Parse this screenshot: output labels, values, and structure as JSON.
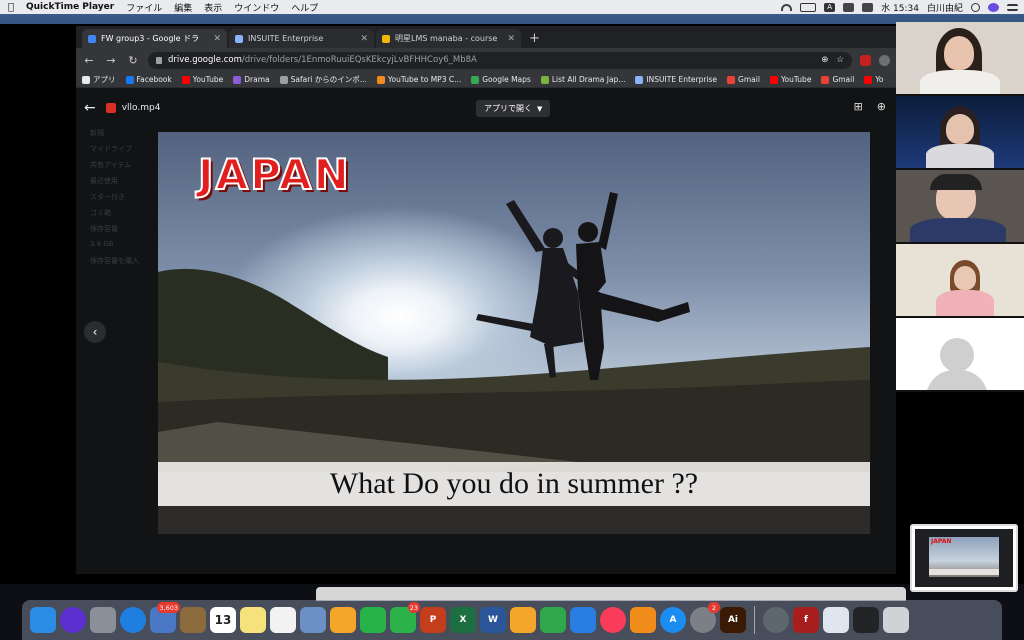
{
  "menubar": {
    "app_name": "QuickTime Player",
    "items": [
      "ファイル",
      "編集",
      "表示",
      "ウインドウ",
      "ヘルプ"
    ],
    "clock": "水 15:34",
    "user": "白川由紀",
    "input_indicator": "A"
  },
  "browser": {
    "tabs": [
      {
        "label": "FW group3 - Google ドラ",
        "color": "#4285f4"
      },
      {
        "label": "INSUITE Enterprise",
        "color": "#8ab4f8"
      },
      {
        "label": "明星LMS manaba - course",
        "color": "#f2b705"
      }
    ],
    "new_tab_symbol": "+",
    "url_host": "drive.google.com",
    "url_path": "/drive/folders/1EnmoRuuiEQsKEkcyjLvBFHHCoy6_Mb8A",
    "bookmarks": [
      {
        "label": "アプリ",
        "color": "#e8eaed"
      },
      {
        "label": "Facebook",
        "color": "#1877f2"
      },
      {
        "label": "YouTube",
        "color": "#ff0000"
      },
      {
        "label": "Drama",
        "color": "#8e5bd9"
      },
      {
        "label": "Safari からのインポ...",
        "color": "#9aa0a6"
      },
      {
        "label": "YouTube to MP3 C...",
        "color": "#f28b1e"
      },
      {
        "label": "Google Maps",
        "color": "#34a853"
      },
      {
        "label": "List All Drama Jap...",
        "color": "#7cb342"
      },
      {
        "label": "INSUITE Enterprise",
        "color": "#8ab4f8"
      },
      {
        "label": "Gmail",
        "color": "#ea4335"
      },
      {
        "label": "YouTube",
        "color": "#ff0000"
      },
      {
        "label": "Gmail",
        "color": "#ea4335"
      },
      {
        "label": "Yo",
        "color": "#ff0000"
      }
    ]
  },
  "drive_preview": {
    "file_name": "vllo.mp4",
    "open_with_label": "アプリで開く",
    "sidebar_items": [
      "新規",
      "マイドライブ",
      "共有アイテム",
      "最近使用",
      "スター付き",
      "ゴミ箱",
      "保存容量",
      "3.8 GB",
      "保存容量を購入"
    ]
  },
  "video": {
    "title_text": "JAPAN",
    "caption": "What Do you do in summer ??"
  },
  "self_view": {
    "title_text": "JAPAN",
    "caption": "What Do you do in summer ??"
  },
  "dock": {
    "apps": [
      {
        "name": "finder",
        "color": "#2b8ce6",
        "label": ""
      },
      {
        "name": "siri",
        "color": "#5b2fd0",
        "label": ""
      },
      {
        "name": "launchpad",
        "color": "#8a8f98",
        "label": ""
      },
      {
        "name": "safari",
        "color": "#1e7fe0",
        "label": ""
      },
      {
        "name": "photos-preview",
        "color": "#4a78c4",
        "label": "",
        "badge": "3,603"
      },
      {
        "name": "notebook",
        "color": "#8b6a3b",
        "label": ""
      },
      {
        "name": "calendar",
        "color": "#ffffff",
        "label": "13"
      },
      {
        "name": "notes",
        "color": "#f6e27a",
        "label": ""
      },
      {
        "name": "reminders",
        "color": "#f2f2f2",
        "label": ""
      },
      {
        "name": "preview",
        "color": "#6d8fc7",
        "label": ""
      },
      {
        "name": "photos",
        "color": "#f4a62a",
        "label": ""
      },
      {
        "name": "messages",
        "color": "#27b24a",
        "label": ""
      },
      {
        "name": "facetime",
        "color": "#2bb34a",
        "label": "",
        "badge": "23"
      },
      {
        "name": "powerpoint",
        "color": "#c43e1c",
        "label": "P"
      },
      {
        "name": "excel",
        "color": "#1d6f42",
        "label": "X"
      },
      {
        "name": "word",
        "color": "#2b579a",
        "label": "W"
      },
      {
        "name": "pages",
        "color": "#f4a62a",
        "label": ""
      },
      {
        "name": "numbers",
        "color": "#2ea84a",
        "label": ""
      },
      {
        "name": "keynote",
        "color": "#2a7de1",
        "label": ""
      },
      {
        "name": "music",
        "color": "#fa3c5a",
        "label": ""
      },
      {
        "name": "books",
        "color": "#f28c1b",
        "label": ""
      },
      {
        "name": "app-store",
        "color": "#1b8cf0",
        "label": "A"
      },
      {
        "name": "system-preferences",
        "color": "#7c7f85",
        "label": "",
        "badge": "2"
      },
      {
        "name": "illustrator",
        "color": "#3a1a05",
        "label": "Ai"
      },
      {
        "name": "quicktime",
        "color": "#5e6670",
        "label": ""
      },
      {
        "name": "flash-player",
        "color": "#a81e1e",
        "label": "f"
      },
      {
        "name": "preview-2",
        "color": "#dfe6ef",
        "label": ""
      },
      {
        "name": "screenshot-folder",
        "color": "#222426",
        "label": ""
      },
      {
        "name": "trash",
        "color": "#cfd3d8",
        "label": ""
      }
    ]
  }
}
